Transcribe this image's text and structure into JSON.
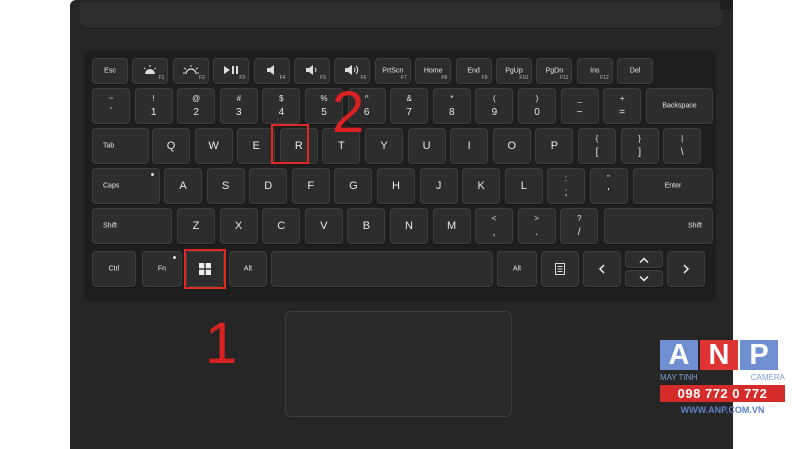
{
  "keyboard": {
    "fn_row": [
      {
        "label": "Esc"
      },
      {
        "icon": "brightness-down-icon",
        "fnum": "F1"
      },
      {
        "icon": "brightness-up-icon",
        "fnum": "F2"
      },
      {
        "icon": "play-pause-icon",
        "fnum": "F3"
      },
      {
        "icon": "volume-mute-icon",
        "fnum": "F4"
      },
      {
        "icon": "volume-down-icon",
        "fnum": "F5"
      },
      {
        "icon": "volume-up-icon",
        "fnum": "F6"
      },
      {
        "label": "PrtScn",
        "fnum": "F7"
      },
      {
        "label": "Home",
        "fnum": "F8"
      },
      {
        "label": "End",
        "fnum": "F9"
      },
      {
        "label": "PgUp",
        "fnum": "F10"
      },
      {
        "label": "PgDn",
        "fnum": "F11"
      },
      {
        "label": "Ins",
        "fnum": "F12"
      },
      {
        "label": "Del"
      }
    ],
    "number_row": [
      {
        "top": "~",
        "bot": "`"
      },
      {
        "top": "!",
        "bot": "1"
      },
      {
        "top": "@",
        "bot": "2"
      },
      {
        "top": "#",
        "bot": "3"
      },
      {
        "top": "$",
        "bot": "4"
      },
      {
        "top": "%",
        "bot": "5"
      },
      {
        "top": "^",
        "bot": "6"
      },
      {
        "top": "&",
        "bot": "7"
      },
      {
        "top": "*",
        "bot": "8"
      },
      {
        "top": "(",
        "bot": "9"
      },
      {
        "top": ")",
        "bot": "0"
      },
      {
        "top": "_",
        "bot": "−"
      },
      {
        "top": "+",
        "bot": "="
      }
    ],
    "backspace": "Backspace",
    "tab": "Tab",
    "qwerty_row": [
      "Q",
      "W",
      "E",
      "R",
      "T",
      "Y",
      "U",
      "I",
      "O",
      "P"
    ],
    "bracket_keys": [
      {
        "top": "{",
        "bot": "["
      },
      {
        "top": "}",
        "bot": "]"
      },
      {
        "top": "|",
        "bot": "\\"
      }
    ],
    "caps": "Caps",
    "home_row": [
      "A",
      "S",
      "D",
      "F",
      "G",
      "H",
      "J",
      "K",
      "L"
    ],
    "punct_home": [
      {
        "top": ":",
        "bot": ";"
      },
      {
        "top": "\"",
        "bot": "'"
      }
    ],
    "enter": "Enter",
    "shift_left": "Shift",
    "bottom_letter_row": [
      "Z",
      "X",
      "C",
      "V",
      "B",
      "N",
      "M"
    ],
    "punct_bottom": [
      {
        "top": "<",
        "bot": ","
      },
      {
        "top": ">",
        "bot": "."
      },
      {
        "top": "?",
        "bot": "/"
      }
    ],
    "shift_right": "Shift",
    "ctrl": "Ctrl",
    "fn": "Fn",
    "alt_left": "Alt",
    "alt_right": "Alt"
  },
  "annotations": {
    "step1": "1",
    "step2": "2"
  },
  "watermark": {
    "letters": [
      "A",
      "N",
      "P"
    ],
    "letter_colors": [
      "#6f8fd0",
      "#e03434",
      "#6f8fd0"
    ],
    "left_text": "MAY TINH",
    "right_text": "CAMERA",
    "phone": "098 772 0 772",
    "website": "WWW.ANP.COM.VN"
  }
}
